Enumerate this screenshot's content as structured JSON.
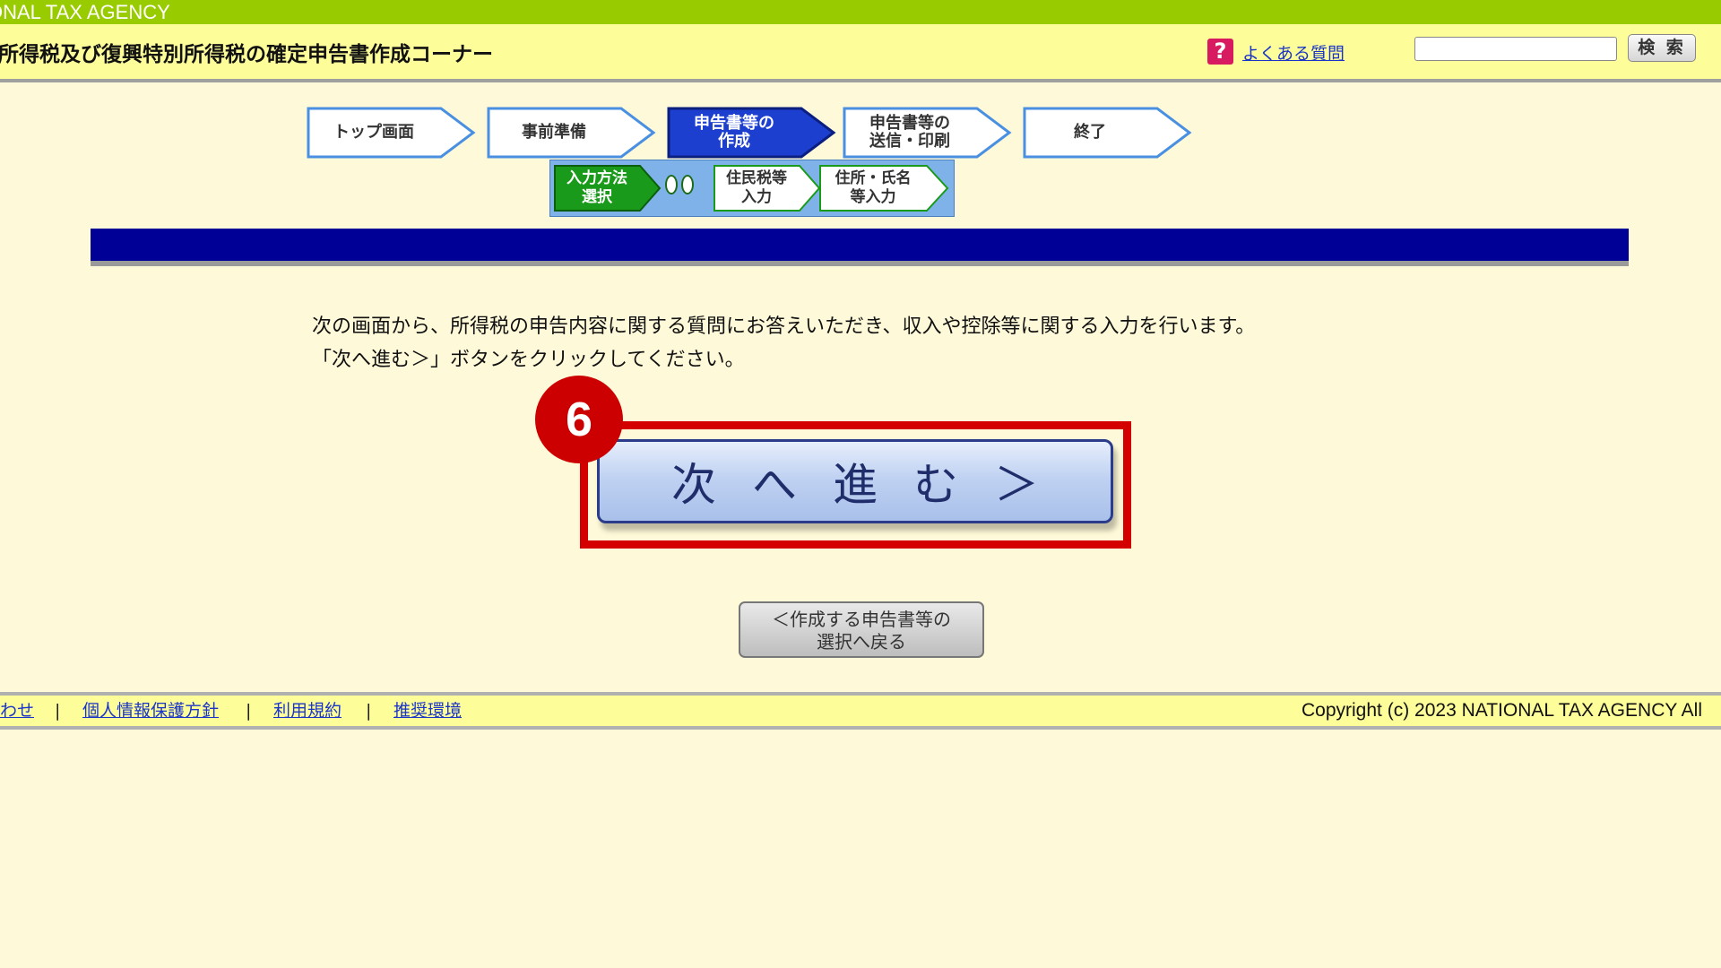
{
  "agency_bar": {
    "text": "ONAL TAX AGENCY"
  },
  "header": {
    "title": "所得税及び復興特別所得税の確定申告書作成コーナー",
    "faq_icon": "?",
    "faq_label": "よくある質問",
    "search_placeholder": "",
    "search_button": "検 索"
  },
  "steps": [
    {
      "label": "トップ画面",
      "active": false
    },
    {
      "label": "事前準備",
      "active": false
    },
    {
      "label": "申告書等の\n作成",
      "active": true
    },
    {
      "label": "申告書等の\n送信・印刷",
      "active": false
    },
    {
      "label": "終了",
      "active": false
    }
  ],
  "substeps": [
    {
      "label": "入力方法\n選択",
      "active": true
    },
    {
      "label": "住民税等\n入力",
      "active": false
    },
    {
      "label": "住所・氏名\n等入力",
      "active": false
    }
  ],
  "instructions": {
    "line1": "次の画面から、所得税の申告内容に関する質問にお答えいただき、収入や控除等に関する入力を行います。",
    "line2": "「次へ進む＞」ボタンをクリックしてください。"
  },
  "annotation": {
    "badge": "6"
  },
  "next_button": {
    "label": "次へ進む＞"
  },
  "back_button": {
    "label": "＜作成する申告書等の\n選択へ戻る"
  },
  "footer": {
    "links": [
      "わせ",
      "個人情報保護方針",
      "利用規約",
      "推奨環境"
    ],
    "separator": "|",
    "copyright": "Copyright (c) 2023 NATIONAL TAX AGENCY All"
  },
  "colors": {
    "agency_bar": "#99cc00",
    "header_bg": "#fdfd9a",
    "page_bg": "#fef9d8",
    "navy_bar": "#000096",
    "active_step": "#1d3fcf",
    "active_substep": "#1a9a1a",
    "highlight": "#d40000"
  }
}
